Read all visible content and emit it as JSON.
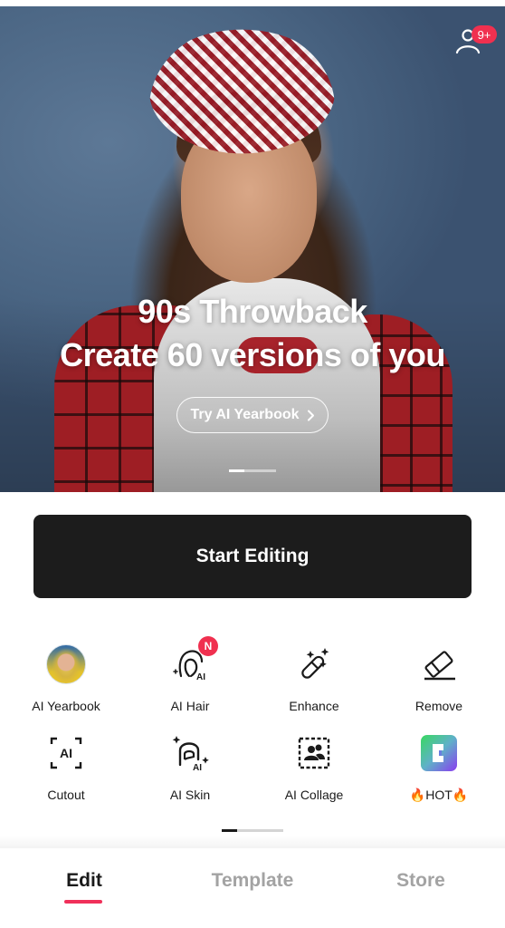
{
  "hero": {
    "title": "90s Throwback",
    "subtitle": "Create 60 versions of you",
    "cta_label": "Try AI Yearbook",
    "cta_icon": "chevron-right-icon",
    "carousel": {
      "current_page": 1,
      "total_pages": 3
    },
    "profile_icon": "user-icon",
    "notification_badge": "9+"
  },
  "start_button": {
    "label": "Start Editing"
  },
  "tools": {
    "items": [
      {
        "label": "AI Yearbook",
        "icon": "ai-yearbook-avatar"
      },
      {
        "label": "AI Hair",
        "icon": "ai-hair-icon",
        "badge": "N"
      },
      {
        "label": "Enhance",
        "icon": "magic-wand-icon"
      },
      {
        "label": "Remove",
        "icon": "eraser-icon"
      },
      {
        "label": "Cutout",
        "icon": "ai-cutout-icon"
      },
      {
        "label": "AI Skin",
        "icon": "ai-skin-icon"
      },
      {
        "label": "AI Collage",
        "icon": "collage-icon"
      },
      {
        "label": "🔥HOT🔥",
        "icon": "hot-app-icon"
      }
    ],
    "pager": {
      "current_page": 1,
      "total_pages": 4
    }
  },
  "bottom_nav": {
    "tabs": [
      {
        "label": "Edit",
        "active": true
      },
      {
        "label": "Template",
        "active": false
      },
      {
        "label": "Store",
        "active": false
      }
    ]
  },
  "colors": {
    "accent": "#f0305a",
    "badge": "#f0304f",
    "primary_button": "#1c1c1c",
    "inactive_tab": "#a3a3a3"
  }
}
